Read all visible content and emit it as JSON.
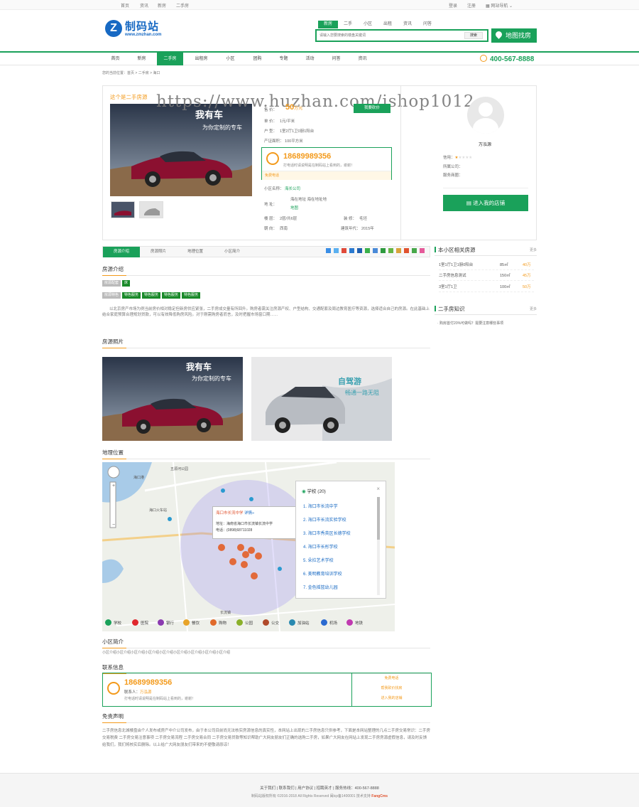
{
  "topbar": {
    "links": [
      "首页",
      "资讯",
      "新房",
      "二手房"
    ],
    "right": [
      "登录",
      "注册",
      "网站导航"
    ]
  },
  "logo": {
    "name": "制码站",
    "url": "www.zmzhan.com"
  },
  "search": {
    "tabs": [
      "新房",
      "二手",
      "小区",
      "出租",
      "资讯",
      "问答"
    ],
    "placeholder": "请输入您要搜索的楼盘关键词",
    "button": "搜索"
  },
  "map_button": "地图找房",
  "nav": {
    "items": [
      "首页",
      "新房",
      "二手房",
      "出租房",
      "小区",
      "团购",
      "专题",
      "活动",
      "问答",
      "资讯"
    ],
    "phone": "400-567-8888"
  },
  "breadcrumb": "您的当前位置：首页 > 二手房 > 海口",
  "watermark": "https://www.huzhan.com/ishop1012",
  "listing": {
    "title": "这个是二手房源",
    "price": "50",
    "price_unit": "万元",
    "deal_btn": "我要砍价",
    "rows": [
      {
        "label": "单 价：",
        "value": "1元/平米"
      },
      {
        "label": "户 型：",
        "value": "1室2厅1卫0厨1阳台"
      },
      {
        "label": "产证面积：",
        "value": "100平方米"
      }
    ],
    "phone": "18689989356",
    "phone_tip": "打电话时请说明是在制码站上看到的，谢谢！",
    "phone_sub": "免费电话",
    "community_label": "小区名称：",
    "community": "海长公司",
    "address_label": "地 址：",
    "address": "海在地址 海在地址地",
    "map_link": "地图",
    "floor_label": "楼 层：",
    "floor": "2层/共6层",
    "decor_label": "装 修：",
    "decor": "毛坯",
    "face_label": "朝 向：",
    "face": "西南",
    "year_label": "建筑年代：",
    "year": "2015年"
  },
  "agent": {
    "name": "万泓源",
    "rating_label": "信用：",
    "company_label": "所属公司：",
    "store_label": "服务商圈：",
    "enter_btn": "进入我的店铺"
  },
  "tabs": [
    "房源介绍",
    "房源照片",
    "地理位置",
    "小区简介"
  ],
  "sections": {
    "intro": "房源介绍",
    "photos": "房源照片",
    "location": "地理位置",
    "community": "小区简介",
    "contact": "联系信息",
    "disclaimer": "免责声明"
  },
  "tags": {
    "row1_label": "房源配套",
    "row1": [
      "床"
    ],
    "row2_label": "房源特色",
    "row2": [
      "特色服务",
      "特色服务",
      "特色服务",
      "特色服务"
    ]
  },
  "intro_text": "以北京房产市场为例当前房价相对稳定但新房供应紧张，二手房成交量有所回升。购房者需关注房源产权、户型结构、交通配套及周边教育医疗等资源，选择适合自己的房源。在此基础上结合家庭预算合理规划贷款，可以有效降低购房风险。对于刚需购房者而言，及时把握市场窗口期……",
  "map": {
    "poi_title": "学校 (20)",
    "poi_items": [
      "1. 海口市长流中学",
      "2. 海口市长流实验学校",
      "3. 海口市秀英区长德学校",
      "4. 海口市长彤学校",
      "5. 朵拉艺术学校",
      "6. 美明教育培训学校",
      "7. 金色摇篮幼儿园"
    ],
    "popup_title": "海口市长流中学",
    "popup_link": "详情»",
    "popup_addr": "地址：海南省海口市长流镇长流中学",
    "popup_tel": "电话：(0898)68711028",
    "labels": [
      "五源河公园",
      "海口火车站",
      "海口港",
      "长流镇"
    ],
    "categories": [
      "学校",
      "医院",
      "银行",
      "餐饮",
      "购物",
      "公园",
      "公交",
      "加油站",
      "机场",
      "地铁"
    ]
  },
  "community_text": "小区介绍小区介绍小区介绍小区介绍小区介绍小区介绍小区介绍小区介绍小区介绍",
  "contact": {
    "phone": "18689989356",
    "name_label": "联系人：",
    "name": "万泓源",
    "tip": "打电话时请说明是在制码站上看到的，谢谢！",
    "links": [
      "免费电话",
      "帮我砍价找房",
      "进入我的店铺"
    ]
  },
  "disclaimer_text": "二手房信息北城楼盘由个人发布或房产中介公司发布，由于本公司目前尚无法核实房源信息的真实性，本网站上出现的二手房信息只供参考，下面是本网站整理的几点二手房交易常识：二手房交易税费 二手房交易注意事项 二手房交易流程 二手房交易合同 二手房交易贷款等知识帮助广大网友朋友们正确的选购二手房，如果广大网友在网站上发现二手房房源虚假信息，请及时反馈给我们，我们将核实后删除。以上给广大网友朋友们带来的不便敬请原谅！",
  "sidebar": {
    "related_title": "本小区相关房源",
    "more": "更多",
    "related": [
      {
        "name": "1室1厅1卫1厨0阳台",
        "area": "85㎡",
        "price": "40万"
      },
      {
        "name": "二手房信息测试",
        "area": "150㎡",
        "price": "45万"
      },
      {
        "name": "3室1厅1卫",
        "area": "100㎡",
        "price": "50万"
      }
    ],
    "knowledge_title": "二手房知识",
    "knowledge_more": "更多",
    "knowledge": [
      "· 购房首付20%可做吗？需要注意哪些事项"
    ]
  },
  "footer": {
    "links": "关于我们 | 联系我们 | 用户协议 | 招聘英才 | 服务热线：400-567-8888",
    "copyright": "制码站版权所有 ©2016-2018 All Rights Reserved 闽icp备1400001  技术支持",
    "brand": "FangCms"
  },
  "colors": {
    "brand": "#1aa15a",
    "accent": "#f39a1b",
    "logo": "#1769c3"
  }
}
